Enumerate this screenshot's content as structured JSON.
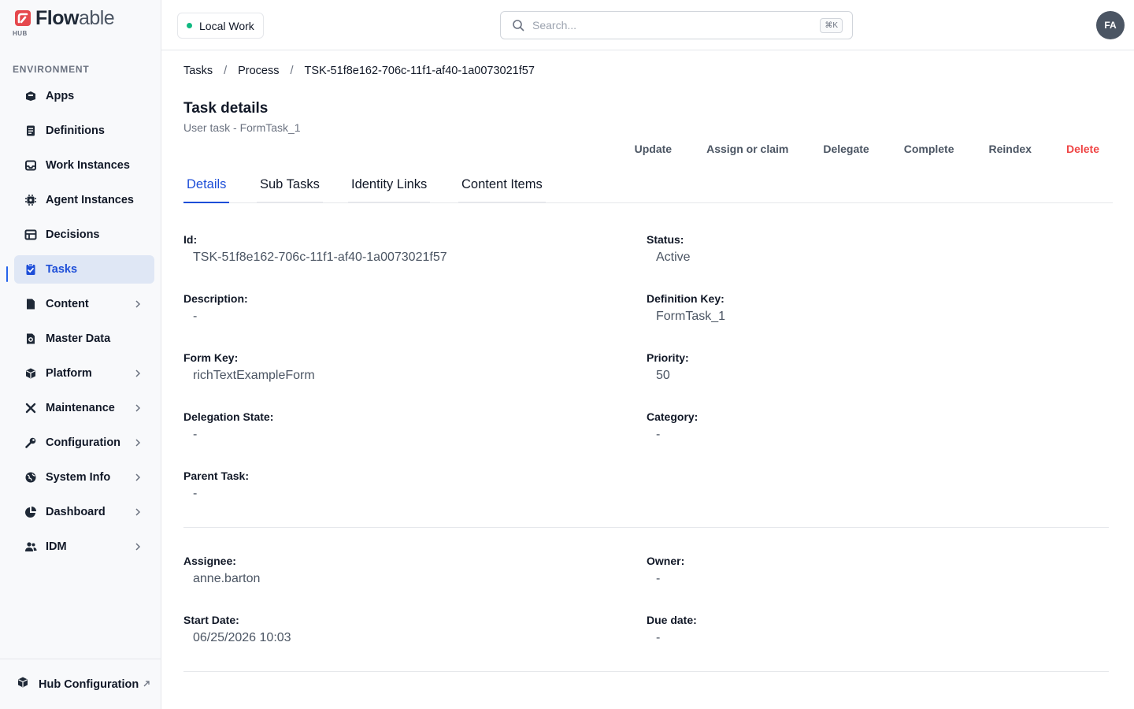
{
  "brand": {
    "name_bold": "Flow",
    "name_light": "able",
    "sub": "HUB"
  },
  "sidebar": {
    "section_label": "ENVIRONMENT",
    "items": [
      {
        "label": "Apps",
        "icon": "apps-icon",
        "chevron": false,
        "active": false
      },
      {
        "label": "Definitions",
        "icon": "definitions-icon",
        "chevron": false,
        "active": false
      },
      {
        "label": "Work Instances",
        "icon": "inbox-icon",
        "chevron": false,
        "active": false
      },
      {
        "label": "Agent Instances",
        "icon": "chip-icon",
        "chevron": false,
        "active": false
      },
      {
        "label": "Decisions",
        "icon": "table-icon",
        "chevron": false,
        "active": false
      },
      {
        "label": "Tasks",
        "icon": "clipboard-check-icon",
        "chevron": false,
        "active": true
      },
      {
        "label": "Content",
        "icon": "document-icon",
        "chevron": true,
        "active": false
      },
      {
        "label": "Master Data",
        "icon": "master-data-icon",
        "chevron": false,
        "active": false
      },
      {
        "label": "Platform",
        "icon": "cube-icon",
        "chevron": true,
        "active": false
      },
      {
        "label": "Maintenance",
        "icon": "tools-icon",
        "chevron": true,
        "active": false
      },
      {
        "label": "Configuration",
        "icon": "wrench-icon",
        "chevron": true,
        "active": false
      },
      {
        "label": "System Info",
        "icon": "globe-icon",
        "chevron": true,
        "active": false
      },
      {
        "label": "Dashboard",
        "icon": "pie-chart-icon",
        "chevron": true,
        "active": false
      },
      {
        "label": "IDM",
        "icon": "users-icon",
        "chevron": true,
        "active": false
      }
    ],
    "footer_label": "Hub Configuration"
  },
  "topbar": {
    "environment": "Local Work",
    "search_placeholder": "Search...",
    "search_shortcut": "⌘K",
    "avatar_initials": "FA"
  },
  "breadcrumb": [
    "Tasks",
    "Process",
    "TSK-51f8e162-706c-11f1-af40-1a0073021f57"
  ],
  "page": {
    "title": "Task details",
    "subtitle": "User task - FormTask_1"
  },
  "actions": [
    "Update",
    "Assign or claim",
    "Delegate",
    "Complete",
    "Reindex",
    "Delete"
  ],
  "tabs": [
    "Details",
    "Sub Tasks",
    "Identity Links",
    "Content Items"
  ],
  "details": {
    "id_label": "Id:",
    "id_value": "TSK-51f8e162-706c-11f1-af40-1a0073021f57",
    "status_label": "Status:",
    "status_value": "Active",
    "description_label": "Description:",
    "description_value": "-",
    "definition_key_label": "Definition Key:",
    "definition_key_value": "FormTask_1",
    "form_key_label": "Form Key:",
    "form_key_value": "richTextExampleForm",
    "priority_label": "Priority:",
    "priority_value": "50",
    "delegation_state_label": "Delegation State:",
    "delegation_state_value": "-",
    "category_label": "Category:",
    "category_value": "-",
    "parent_task_label": "Parent Task:",
    "parent_task_value": "-",
    "assignee_label": "Assignee:",
    "assignee_value": "anne.barton",
    "owner_label": "Owner:",
    "owner_value": "-",
    "start_date_label": "Start Date:",
    "start_date_value": "06/25/2026 10:03",
    "due_date_label": "Due date:",
    "due_date_value": "-"
  },
  "colors": {
    "accent": "#1d4ed8",
    "danger": "#ef4444",
    "status_dot": "#10b981",
    "brand": "#e11d48"
  }
}
